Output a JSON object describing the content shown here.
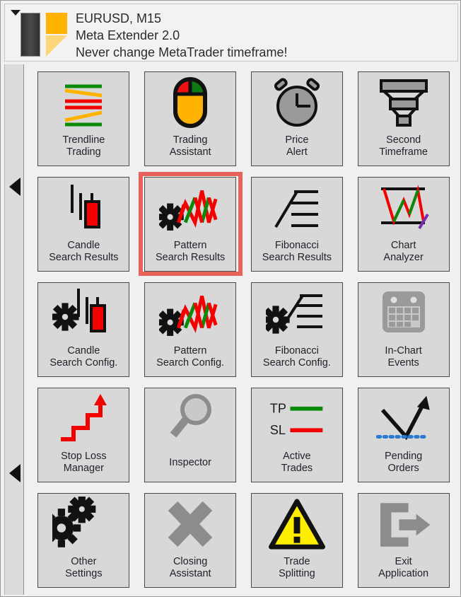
{
  "header": {
    "caret_icon": "triangle-down-icon",
    "logo_icon": "meta-extender-logo",
    "line1": "EURUSD, M15",
    "line2": "Meta Extender 2.0",
    "line3": "Never change MetaTrader timeframe!"
  },
  "rail": {
    "scroll_up_icon": "triangle-left-icon",
    "scroll_down_icon": "triangle-left-icon"
  },
  "colors": {
    "highlight": "#e8625c",
    "tile_bg": "#d8d8d8",
    "panel_bg": "#f0f0f0",
    "accent_orange": "#ffb300",
    "green": "#0a8a0a",
    "red": "#f40000",
    "gray_disabled": "#8c8c8c",
    "purple": "#7a2fb0",
    "yellow": "#ffee00",
    "blue_dot": "#2a7ad4"
  },
  "grid": {
    "columns": 4,
    "rows": 5,
    "tiles": [
      {
        "id": "trendline-trading",
        "label": "Trendline\nTrading",
        "icon": "trendline-lines-icon",
        "selected": false
      },
      {
        "id": "trading-assistant",
        "label": "Trading\nAssistant",
        "icon": "mouse-icon",
        "selected": false
      },
      {
        "id": "price-alert",
        "label": "Price\nAlert",
        "icon": "alarm-clock-icon",
        "selected": false
      },
      {
        "id": "second-timeframe",
        "label": "Second\nTimeframe",
        "icon": "funnel-icon",
        "selected": false
      },
      {
        "id": "candle-search-results",
        "label": "Candle\nSearch Results",
        "icon": "candlestick-icon",
        "selected": false
      },
      {
        "id": "pattern-search-results",
        "label": "Pattern\nSearch Results",
        "icon": "gear-zigzag-icon",
        "selected": true
      },
      {
        "id": "fibonacci-search-results",
        "label": "Fibonacci\nSearch Results",
        "icon": "fibonacci-icon",
        "selected": false
      },
      {
        "id": "chart-analyzer",
        "label": "Chart\nAnalyzer",
        "icon": "chart-channel-icon",
        "selected": false
      },
      {
        "id": "candle-search-config",
        "label": "Candle\nSearch Config.",
        "icon": "gear-candlestick-icon",
        "selected": false
      },
      {
        "id": "pattern-search-config",
        "label": "Pattern\nSearch Config.",
        "icon": "gear-zigzag-icon",
        "selected": false
      },
      {
        "id": "fibonacci-search-config",
        "label": "Fibonacci\nSearch Config.",
        "icon": "gear-fibonacci-icon",
        "selected": false
      },
      {
        "id": "in-chart-events",
        "label": "In-Chart\nEvents",
        "icon": "calendar-icon",
        "selected": false
      },
      {
        "id": "stop-loss-manager",
        "label": "Stop Loss\nManager",
        "icon": "staircase-arrow-icon",
        "selected": false
      },
      {
        "id": "inspector",
        "label": "Inspector",
        "icon": "magnifier-icon",
        "selected": false
      },
      {
        "id": "active-trades",
        "label": "Active\nTrades",
        "icon": "tp-sl-lines-icon",
        "selected": false
      },
      {
        "id": "pending-orders",
        "label": "Pending\nOrders",
        "icon": "v-arrow-dotted-icon",
        "selected": false
      },
      {
        "id": "other-settings",
        "label": "Other\nSettings",
        "icon": "gears-icon",
        "selected": false
      },
      {
        "id": "closing-assistant",
        "label": "Closing\nAssistant",
        "icon": "cross-icon",
        "selected": false
      },
      {
        "id": "trade-splitting",
        "label": "Trade\nSplitting",
        "icon": "warning-triangle-icon",
        "selected": false
      },
      {
        "id": "exit-application",
        "label": "Exit\nApplication",
        "icon": "exit-arrow-icon",
        "selected": false
      }
    ],
    "icon_legend": {
      "active_trades_tp": "TP",
      "active_trades_sl": "SL"
    }
  }
}
